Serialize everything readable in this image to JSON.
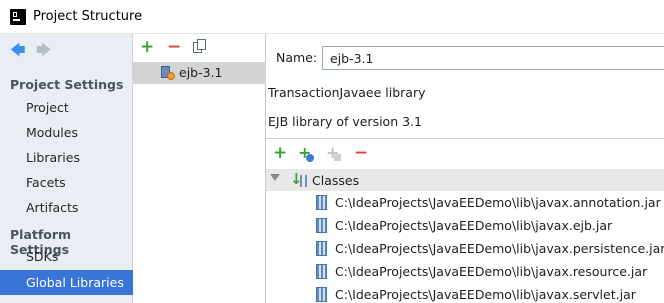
{
  "window": {
    "title": "Project Structure"
  },
  "nav": {
    "back_icon": "arrow-left-icon",
    "forward_icon": "arrow-right-icon",
    "project_settings_header": "Project Settings",
    "project_items": [
      "Project",
      "Modules",
      "Libraries",
      "Facets",
      "Artifacts"
    ],
    "platform_settings_header": "Platform Settings",
    "platform_items": [
      "SDKs",
      "Global Libraries"
    ],
    "selected_item": "Global Libraries"
  },
  "libraries": {
    "toolbar": {
      "add": "+",
      "remove": "−",
      "copy_icon": "copy-icon"
    },
    "items": [
      "ejb-3.1"
    ]
  },
  "details": {
    "name_label": "Name:",
    "name_value": "ejb-3.1",
    "description_line1": "TransactionJavaee library",
    "description_line2": "EJB library of version 3.1",
    "toolbar": {
      "add": "+",
      "add_special_icon": "add-with-globe-icon",
      "add_disabled_icon": "add-disabled-icon",
      "remove": "−"
    },
    "tree": {
      "root_label": "Classes",
      "jars": [
        "C:\\IdeaProjects\\JavaEEDemo\\lib\\javax.annotation.jar",
        "C:\\IdeaProjects\\JavaEEDemo\\lib\\javax.ejb.jar",
        "C:\\IdeaProjects\\JavaEEDemo\\lib\\javax.persistence.jar",
        "C:\\IdeaProjects\\JavaEEDemo\\lib\\javax.resource.jar",
        "C:\\IdeaProjects\\JavaEEDemo\\lib\\javax.servlet.jar"
      ]
    }
  },
  "colors": {
    "selection": "#3875d7",
    "nav_background": "#e9eef5",
    "add_green": "#3aa23a",
    "remove_red": "#d8463c"
  }
}
